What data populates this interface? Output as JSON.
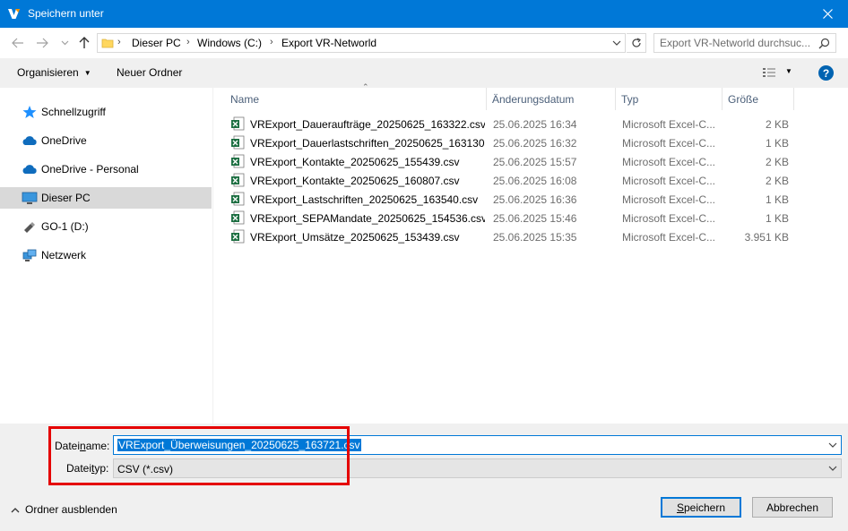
{
  "window": {
    "title": "Speichern unter"
  },
  "address": {
    "breadcrumbs": [
      "Dieser PC",
      "Windows (C:)",
      "Export VR-Networld"
    ],
    "search_placeholder": "Export VR-Networld durchsuc..."
  },
  "toolbar": {
    "organize": "Organisieren",
    "new_folder": "Neuer Ordner",
    "help": "?"
  },
  "sidebar": {
    "items": [
      {
        "label": "Schnellzugriff",
        "icon": "star-icon"
      },
      {
        "label": "OneDrive",
        "icon": "cloud-icon"
      },
      {
        "label": "OneDrive - Personal",
        "icon": "cloud-icon"
      },
      {
        "label": "Dieser PC",
        "icon": "computer-icon",
        "selected": true
      },
      {
        "label": "GO-1 (D:)",
        "icon": "usb-drive-icon"
      },
      {
        "label": "Netzwerk",
        "icon": "network-icon"
      }
    ]
  },
  "columns": {
    "name": "Name",
    "date": "Änderungsdatum",
    "type": "Typ",
    "size": "Größe"
  },
  "files": [
    {
      "name": "VRExport_Daueraufträge_20250625_163322.csv",
      "date": "25.06.2025 16:34",
      "type": "Microsoft Excel-C...",
      "size": "2 KB"
    },
    {
      "name": "VRExport_Dauerlastschriften_20250625_163130....",
      "date": "25.06.2025 16:32",
      "type": "Microsoft Excel-C...",
      "size": "1 KB"
    },
    {
      "name": "VRExport_Kontakte_20250625_155439.csv",
      "date": "25.06.2025 15:57",
      "type": "Microsoft Excel-C...",
      "size": "2 KB"
    },
    {
      "name": "VRExport_Kontakte_20250625_160807.csv",
      "date": "25.06.2025 16:08",
      "type": "Microsoft Excel-C...",
      "size": "2 KB"
    },
    {
      "name": "VRExport_Lastschriften_20250625_163540.csv",
      "date": "25.06.2025 16:36",
      "type": "Microsoft Excel-C...",
      "size": "1 KB"
    },
    {
      "name": "VRExport_SEPAMandate_20250625_154536.csv",
      "date": "25.06.2025 15:46",
      "type": "Microsoft Excel-C...",
      "size": "1 KB"
    },
    {
      "name": "VRExport_Umsätze_20250625_153439.csv",
      "date": "25.06.2025 15:35",
      "type": "Microsoft Excel-C...",
      "size": "3.951 KB"
    }
  ],
  "form": {
    "filename_label_pre": "Datei",
    "filename_label_ul": "n",
    "filename_label_post": "ame:",
    "filename_value": "VRExport_Überweisungen_20250625_163721.csv",
    "filetype_label_pre": "Datei",
    "filetype_label_ul": "t",
    "filetype_label_post": "yp:",
    "filetype_value": "CSV (*.csv)"
  },
  "footer": {
    "hide_folders": "Ordner ausblenden",
    "save_pre": "",
    "save_ul": "S",
    "save_post": "peichern",
    "cancel": "Abbrechen"
  },
  "colors": {
    "titlebar": "#0078d7",
    "highlight": "#e50000",
    "selection": "#0078d7"
  }
}
